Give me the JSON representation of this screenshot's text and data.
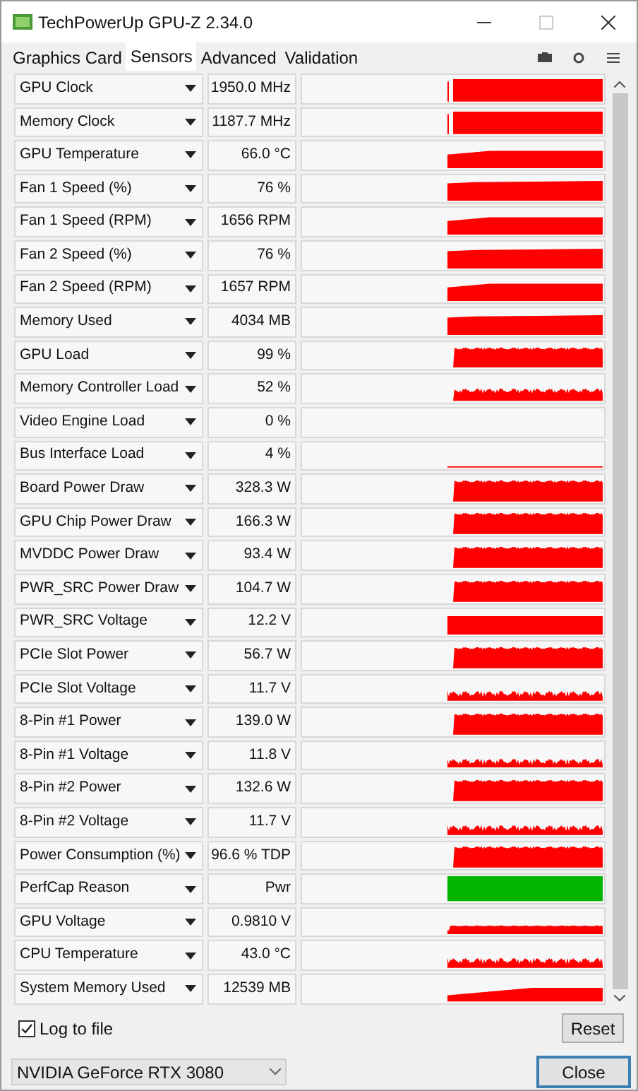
{
  "window": {
    "title": "TechPowerUp GPU-Z 2.34.0"
  },
  "tabs": [
    {
      "label": "Graphics Card",
      "selected": false
    },
    {
      "label": "Sensors",
      "selected": true
    },
    {
      "label": "Advanced",
      "selected": false
    },
    {
      "label": "Validation",
      "selected": false
    }
  ],
  "sensors": [
    {
      "name": "GPU Clock",
      "value": "1950.0 MHz"
    },
    {
      "name": "Memory Clock",
      "value": "1187.7 MHz"
    },
    {
      "name": "GPU Temperature",
      "value": "66.0 °C"
    },
    {
      "name": "Fan 1 Speed (%)",
      "value": "76 %"
    },
    {
      "name": "Fan 1 Speed (RPM)",
      "value": "1656 RPM"
    },
    {
      "name": "Fan 2 Speed (%)",
      "value": "76 %"
    },
    {
      "name": "Fan 2 Speed (RPM)",
      "value": "1657 RPM"
    },
    {
      "name": "Memory Used",
      "value": "4034 MB"
    },
    {
      "name": "GPU Load",
      "value": "99 %"
    },
    {
      "name": "Memory Controller Load",
      "value": "52 %"
    },
    {
      "name": "Video Engine Load",
      "value": "0 %"
    },
    {
      "name": "Bus Interface Load",
      "value": "4 %"
    },
    {
      "name": "Board Power Draw",
      "value": "328.3 W"
    },
    {
      "name": "GPU Chip Power Draw",
      "value": "166.3 W"
    },
    {
      "name": "MVDDC Power Draw",
      "value": "93.4 W"
    },
    {
      "name": "PWR_SRC Power Draw",
      "value": "104.7 W"
    },
    {
      "name": "PWR_SRC Voltage",
      "value": "12.2 V"
    },
    {
      "name": "PCIe Slot Power",
      "value": "56.7 W"
    },
    {
      "name": "PCIe Slot Voltage",
      "value": "11.7 V"
    },
    {
      "name": "8-Pin #1 Power",
      "value": "139.0 W"
    },
    {
      "name": "8-Pin #1 Voltage",
      "value": "11.8 V"
    },
    {
      "name": "8-Pin #2 Power",
      "value": "132.6 W"
    },
    {
      "name": "8-Pin #2 Voltage",
      "value": "11.7 V"
    },
    {
      "name": "Power Consumption (%)",
      "value": "96.6 % TDP"
    },
    {
      "name": "PerfCap Reason",
      "value": "Pwr"
    },
    {
      "name": "GPU Voltage",
      "value": "0.9810 V"
    },
    {
      "name": "CPU Temperature",
      "value": "43.0 °C"
    },
    {
      "name": "System Memory Used",
      "value": "12539 MB"
    }
  ],
  "log_to_file": {
    "label": "Log to file",
    "checked": true
  },
  "reset_button": "Reset",
  "device_select": "NVIDIA GeForce RTX 3080",
  "close_button": "Close"
}
